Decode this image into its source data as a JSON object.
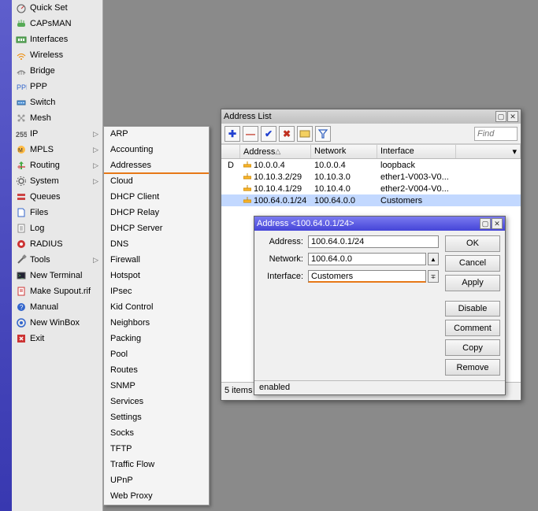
{
  "sidebar": [
    {
      "label": "Quick Set",
      "icon": "gauge",
      "arrow": false
    },
    {
      "label": "CAPsMAN",
      "icon": "cap",
      "arrow": false
    },
    {
      "label": "Interfaces",
      "icon": "iface",
      "arrow": false
    },
    {
      "label": "Wireless",
      "icon": "wifi",
      "arrow": false
    },
    {
      "label": "Bridge",
      "icon": "bridge",
      "arrow": false
    },
    {
      "label": "PPP",
      "icon": "ppp",
      "arrow": false
    },
    {
      "label": "Switch",
      "icon": "switch",
      "arrow": false
    },
    {
      "label": "Mesh",
      "icon": "mesh",
      "arrow": false
    },
    {
      "label": "IP",
      "icon": "ip",
      "arrow": true
    },
    {
      "label": "MPLS",
      "icon": "mpls",
      "arrow": true
    },
    {
      "label": "Routing",
      "icon": "routing",
      "arrow": true
    },
    {
      "label": "System",
      "icon": "gear",
      "arrow": true
    },
    {
      "label": "Queues",
      "icon": "queues",
      "arrow": false
    },
    {
      "label": "Files",
      "icon": "files",
      "arrow": false
    },
    {
      "label": "Log",
      "icon": "log",
      "arrow": false
    },
    {
      "label": "RADIUS",
      "icon": "radius",
      "arrow": false
    },
    {
      "label": "Tools",
      "icon": "tools",
      "arrow": true
    },
    {
      "label": "New Terminal",
      "icon": "terminal",
      "arrow": false
    },
    {
      "label": "Make Supout.rif",
      "icon": "supout",
      "arrow": false
    },
    {
      "label": "Manual",
      "icon": "manual",
      "arrow": false
    },
    {
      "label": "New WinBox",
      "icon": "winbox",
      "arrow": false
    },
    {
      "label": "Exit",
      "icon": "exit",
      "arrow": false
    }
  ],
  "submenu": [
    "ARP",
    "Accounting",
    "Addresses",
    "Cloud",
    "DHCP Client",
    "DHCP Relay",
    "DHCP Server",
    "DNS",
    "Firewall",
    "Hotspot",
    "IPsec",
    "Kid Control",
    "Neighbors",
    "Packing",
    "Pool",
    "Routes",
    "SNMP",
    "Services",
    "Settings",
    "Socks",
    "TFTP",
    "Traffic Flow",
    "UPnP",
    "Web Proxy"
  ],
  "submenu_highlighted": "Addresses",
  "addrlist": {
    "title": "Address List",
    "find_placeholder": "Find",
    "columns": [
      "Address",
      "Network",
      "Interface"
    ],
    "rows": [
      {
        "flag": "D",
        "address": "10.0.0.4",
        "network": "10.0.0.4",
        "interface": "loopback"
      },
      {
        "flag": "",
        "address": "10.10.3.2/29",
        "network": "10.10.3.0",
        "interface": "ether1-V003-V0..."
      },
      {
        "flag": "",
        "address": "10.10.4.1/29",
        "network": "10.10.4.0",
        "interface": "ether2-V004-V0..."
      },
      {
        "flag": "",
        "address": "100.64.0.1/24",
        "network": "100.64.0.0",
        "interface": "Customers",
        "selected": true
      }
    ],
    "status_count": "5 items",
    "status_text": "enabled",
    "selected_index": 3
  },
  "addredit": {
    "title": "Address <100.64.0.1/24>",
    "fields": {
      "address_label": "Address:",
      "address_value": "100.64.0.1/24",
      "network_label": "Network:",
      "network_value": "100.64.0.0",
      "interface_label": "Interface:",
      "interface_value": "Customers"
    },
    "buttons": [
      "OK",
      "Cancel",
      "Apply",
      "Disable",
      "Comment",
      "Copy",
      "Remove"
    ],
    "status": "enabled"
  }
}
